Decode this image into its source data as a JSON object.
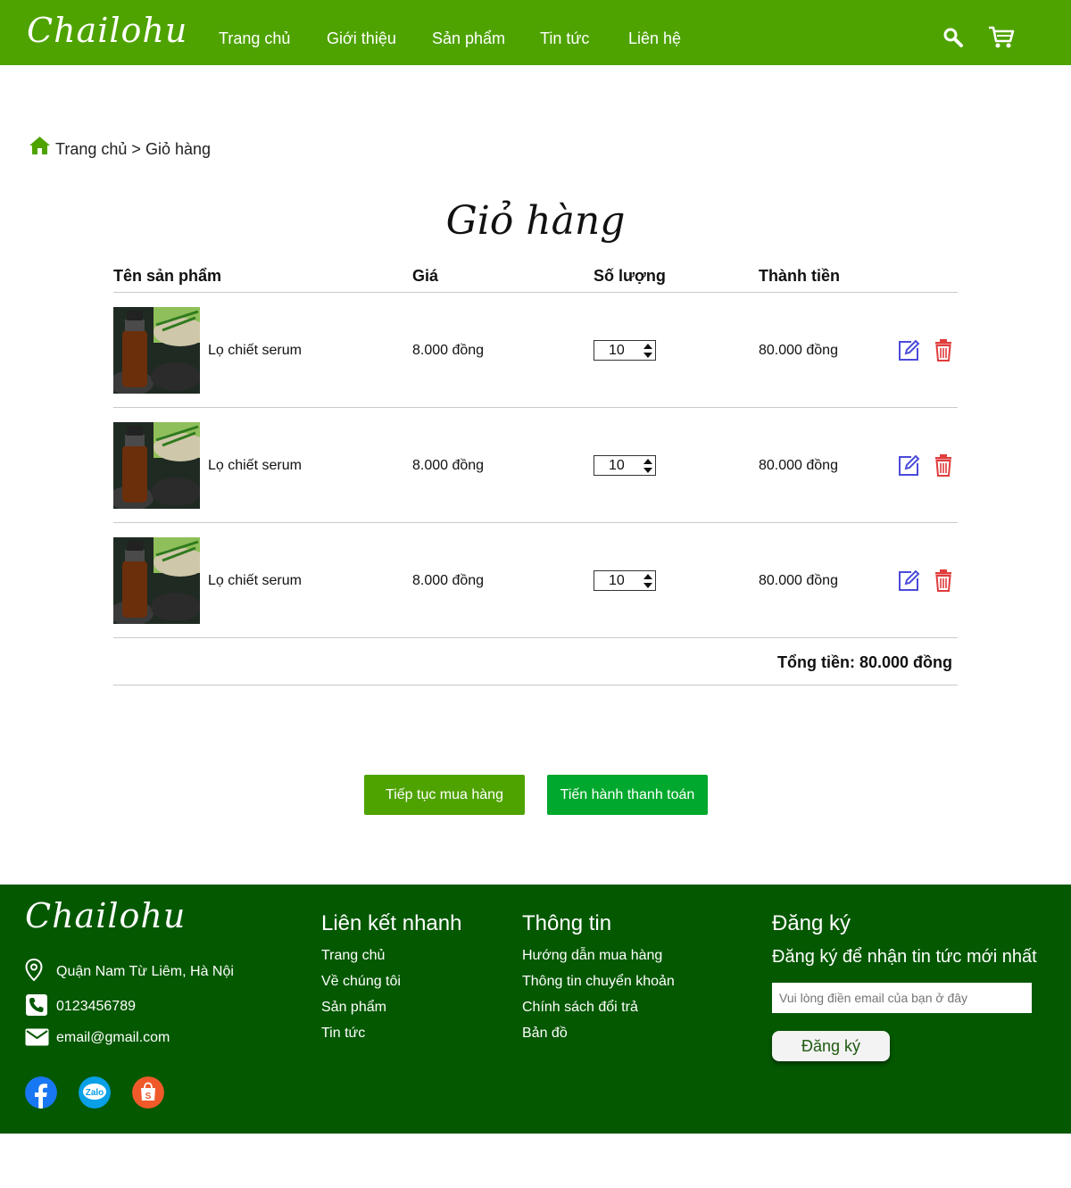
{
  "header": {
    "logo": "Chailohu",
    "nav": [
      "Trang chủ",
      "Giới thiệu",
      "Sản phẩm",
      "Tin tức",
      "Liên hệ"
    ],
    "icons": [
      "search-icon",
      "cart-icon"
    ]
  },
  "breadcrumb": {
    "home": "Trang chủ",
    "separator": ">",
    "current": "Giỏ hàng"
  },
  "page_title": "Giỏ hàng",
  "table": {
    "headers": [
      "Tên sản phẩm",
      "Giá",
      "Số lượng",
      "Thành tiền"
    ],
    "rows": [
      {
        "name": "Lọ chiết serum",
        "price": "8.000 đồng",
        "quantity": "10",
        "subtotal": "80.000 đồng"
      },
      {
        "name": "Lọ chiết serum",
        "price": "8.000 đồng",
        "quantity": "10",
        "subtotal": "80.000 đồng"
      },
      {
        "name": "Lọ chiết serum",
        "price": "8.000 đồng",
        "quantity": "10",
        "subtotal": "80.000 đồng"
      }
    ],
    "total": "Tổng tiền: 80.000 đồng"
  },
  "buttons": {
    "continue": "Tiếp tục mua hàng",
    "checkout": "Tiến hành thanh toán"
  },
  "footer": {
    "logo": "Chailohu",
    "address": "Quận Nam Từ Liêm, Hà Nội",
    "phone": "0123456789",
    "email": "email@gmail.com",
    "quick_links": {
      "title": "Liên kết nhanh",
      "items": [
        "Trang chủ",
        "Về chúng tôi",
        "Sản phẩm",
        "Tin tức"
      ]
    },
    "info": {
      "title": "Thông tin",
      "items": [
        "Hướng dẫn mua hàng",
        "Thông tin chuyển khoản",
        "Chính sách đổi trả",
        "Bản đồ"
      ]
    },
    "subscribe": {
      "title": "Đăng ký",
      "subtitle": "Đăng ký để nhận tin tức mới nhất",
      "placeholder": "Vui lòng điền email của bạn ở đây",
      "button": "Đăng ký"
    },
    "social": [
      "facebook-icon",
      "zalo-icon",
      "shopee-icon"
    ]
  },
  "colors": {
    "header": "#4fa300",
    "footer": "#045800",
    "continue_btn": "#4fa300",
    "checkout_btn": "#00a82d",
    "edit_icon": "#4b4bdb",
    "delete_icon": "#e03c3c"
  }
}
